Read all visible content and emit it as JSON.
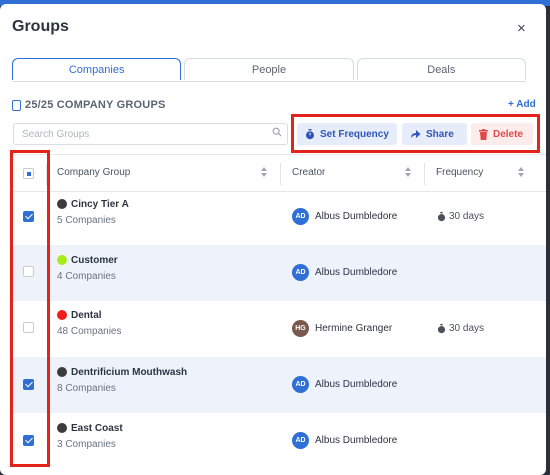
{
  "modal": {
    "title": "Groups",
    "close_glyph": "×"
  },
  "tabs": [
    {
      "label": "Companies",
      "active": true
    },
    {
      "label": "People",
      "active": false
    },
    {
      "label": "Deals",
      "active": false
    }
  ],
  "summary": {
    "count_label": "25/25 COMPANY GROUPS",
    "add_label": "+ Add"
  },
  "search": {
    "placeholder": "Search Groups"
  },
  "actions": {
    "set_frequency": "Set Frequency",
    "share": "Share",
    "delete": "Delete"
  },
  "table": {
    "columns": [
      "Company Group",
      "Creator",
      "Frequency"
    ],
    "rows": [
      {
        "name": "Cincy Tier A",
        "sub": "5 Companies",
        "dot": "#3c3c3c",
        "checked": true,
        "creator": "Albus Dumbledore",
        "initials": "AD",
        "avatar_color": "#2f6fd6",
        "frequency": "30 days"
      },
      {
        "name": "Customer",
        "sub": "4 Companies",
        "dot": "#a6ea1f",
        "checked": false,
        "creator": "Albus Dumbledore",
        "initials": "AD",
        "avatar_color": "#2f6fd6",
        "frequency": ""
      },
      {
        "name": "Dental",
        "sub": "48 Companies",
        "dot": "#f01c1c",
        "checked": false,
        "creator": "Hermine Granger",
        "initials": "HG",
        "avatar_color": "#7a5a4e",
        "frequency": "30 days"
      },
      {
        "name": "Dentrificium Mouthwash",
        "sub": "8 Companies",
        "dot": "#3c3c3c",
        "checked": true,
        "creator": "Albus Dumbledore",
        "initials": "AD",
        "avatar_color": "#2f6fd6",
        "frequency": ""
      },
      {
        "name": "East Coast",
        "sub": "3 Companies",
        "dot": "#3c3c3c",
        "checked": true,
        "creator": "Albus Dumbledore",
        "initials": "AD",
        "avatar_color": "#2f6fd6",
        "frequency": ""
      }
    ]
  },
  "colors": {
    "accent": "#2f6fd6",
    "danger": "#e04a4a",
    "highlight": "#e4231a"
  }
}
